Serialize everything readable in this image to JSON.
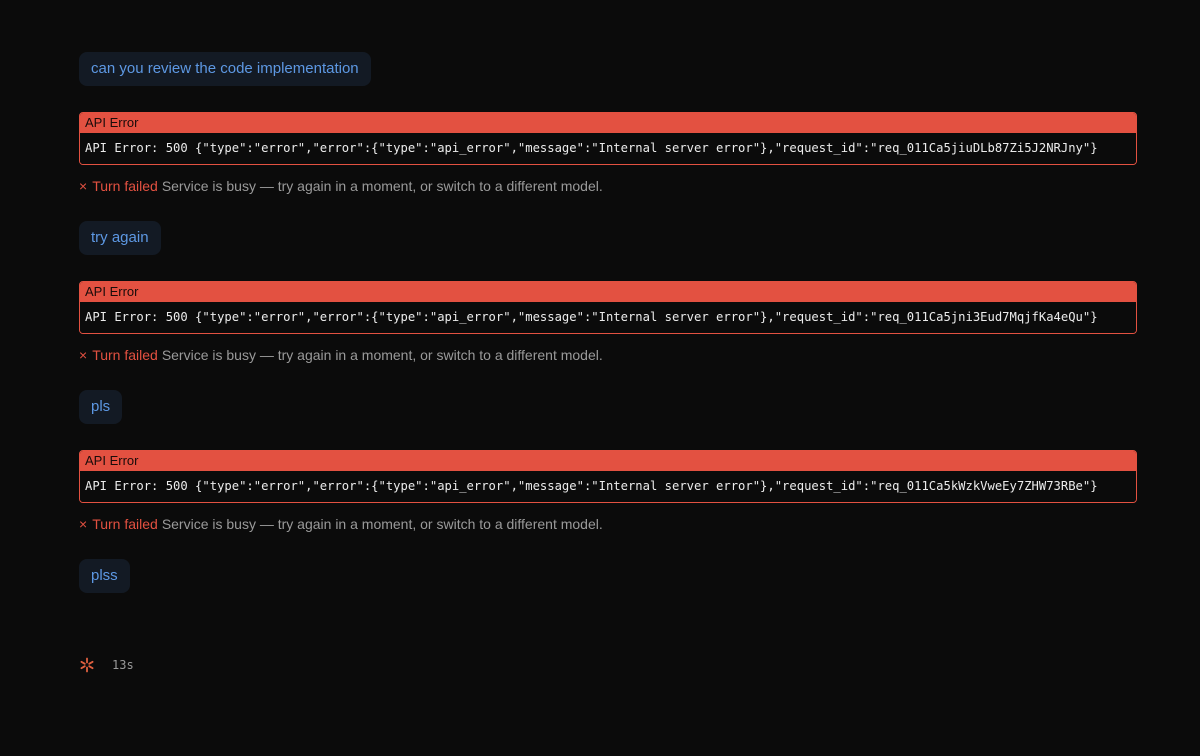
{
  "messages": [
    {
      "user": "can you review the code implementation",
      "error_header": "API Error",
      "error_body": "API Error: 500 {\"type\":\"error\",\"error\":{\"type\":\"api_error\",\"message\":\"Internal server error\"},\"request_id\":\"req_011Ca5jiuDLb87Zi5J2NRJny\"}",
      "status_icon": "×",
      "status_label": "Turn failed",
      "status_text": "Service is busy — try again in a moment, or switch to a different model."
    },
    {
      "user": "try again",
      "error_header": "API Error",
      "error_body": "API Error: 500 {\"type\":\"error\",\"error\":{\"type\":\"api_error\",\"message\":\"Internal server error\"},\"request_id\":\"req_011Ca5jni3Eud7MqjfKa4eQu\"}",
      "status_icon": "×",
      "status_label": "Turn failed",
      "status_text": "Service is busy — try again in a moment, or switch to a different model."
    },
    {
      "user": "pls",
      "error_header": "API Error",
      "error_body": "API Error: 500 {\"type\":\"error\",\"error\":{\"type\":\"api_error\",\"message\":\"Internal server error\"},\"request_id\":\"req_011Ca5kWzkVweEy7ZHW73RBe\"}",
      "status_icon": "×",
      "status_label": "Turn failed",
      "status_text": "Service is busy — try again in a moment, or switch to a different model."
    }
  ],
  "pending_message": "plss",
  "footer": {
    "spinner_icon": "asterisk-spinner-icon",
    "elapsed": "13s"
  },
  "colors": {
    "background": "#0b0b0b",
    "user_bubble": "#131a24",
    "user_text": "#5d98e3",
    "error_accent": "#e35141",
    "muted_text": "#9a9a9a"
  }
}
